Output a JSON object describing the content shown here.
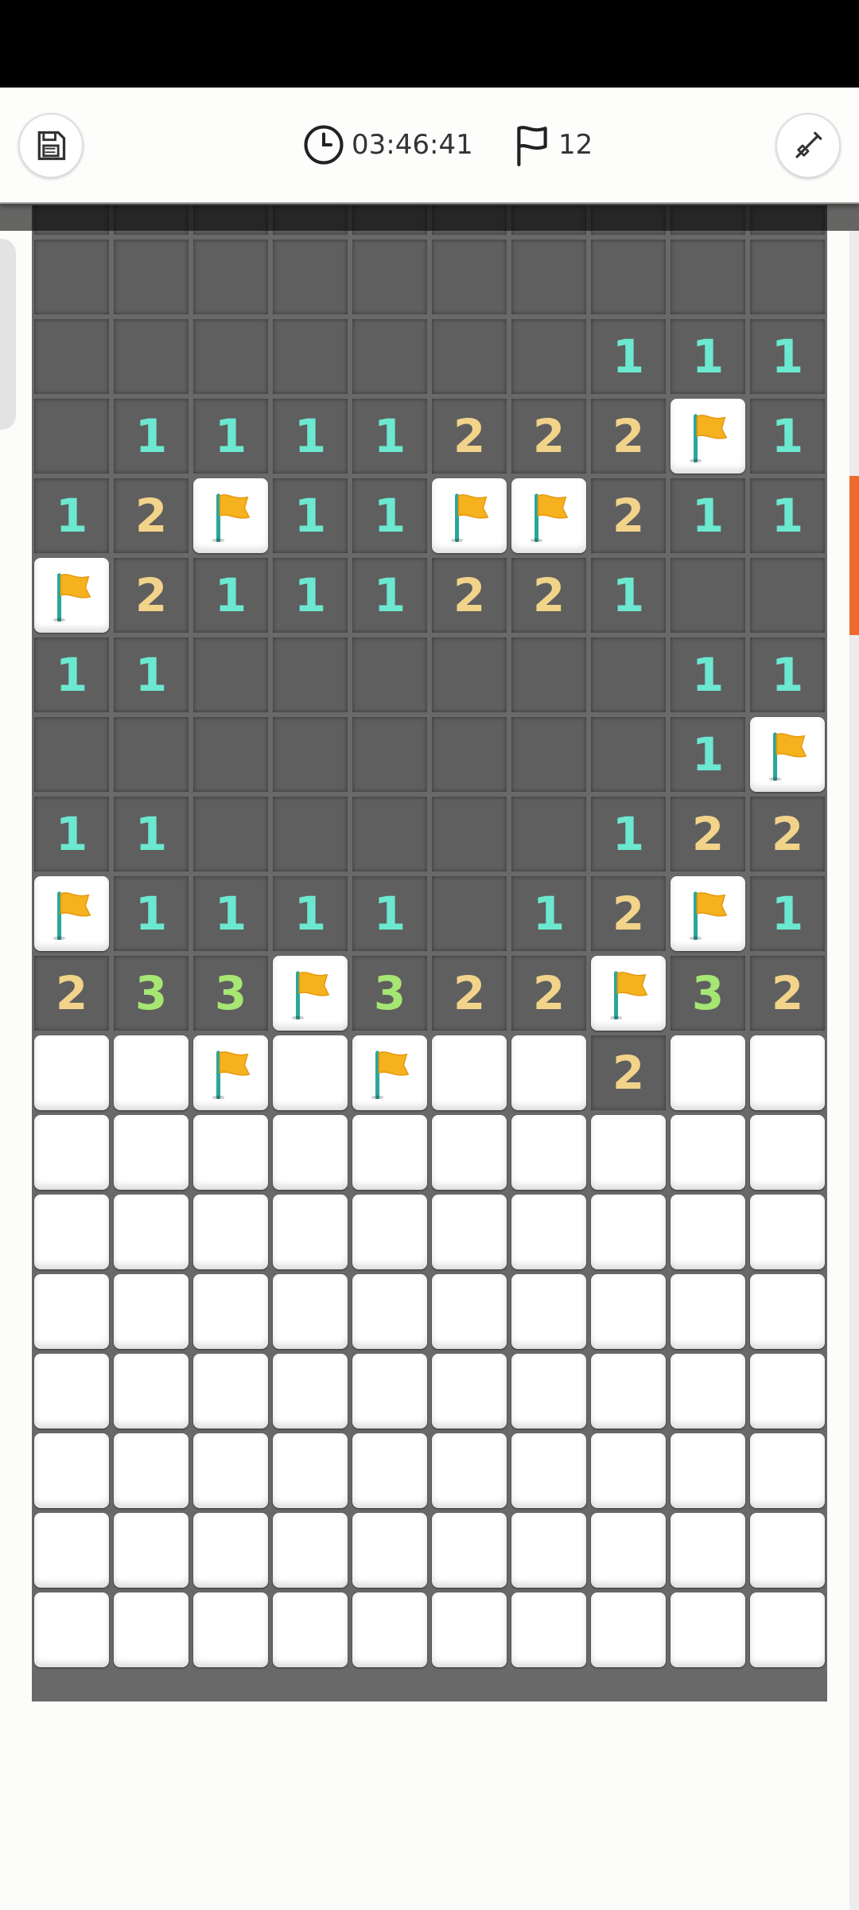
{
  "toolbar": {
    "timer": "03:46:41",
    "flags_remaining": "12",
    "save_icon": "floppy-disk-icon",
    "timer_icon": "clock-icon",
    "flag_icon": "flag-outline-icon",
    "tool_icon": "shovel-icon"
  },
  "board": {
    "columns": 10,
    "rows": [
      ". . . . . . . . . .",
      ". . . . . . . . . .",
      ". . . . . . . 1 1 1",
      ". 1 1 1 1 2 2 2 F 1",
      "1 2 F 1 1 F F 2 1 1",
      "F 2 1 1 1 2 2 1 . .",
      "1 1 . . . . . . 1 1",
      ". . . . . . . . 1 F",
      "1 1 . . . . . 1 2 2",
      "F 1 1 1 1 . 1 2 F 1",
      "2 3 3 F 3 2 2 F 3 2",
      "# # F # F # # 2 # #",
      "# # # # # # # # # #",
      "# # # # # # # # # #",
      "# # # # # # # # # #",
      "# # # # # # # # # #",
      "# # # # # # # # # #",
      "# # # # # # # # # #",
      "# # # # # # # # # #"
    ]
  },
  "colors": {
    "num1": "#6ce8d0",
    "num2": "#f2d38a",
    "num3": "#a6e673",
    "flag": "#f5b21e",
    "accent": "#ee6a2c"
  }
}
